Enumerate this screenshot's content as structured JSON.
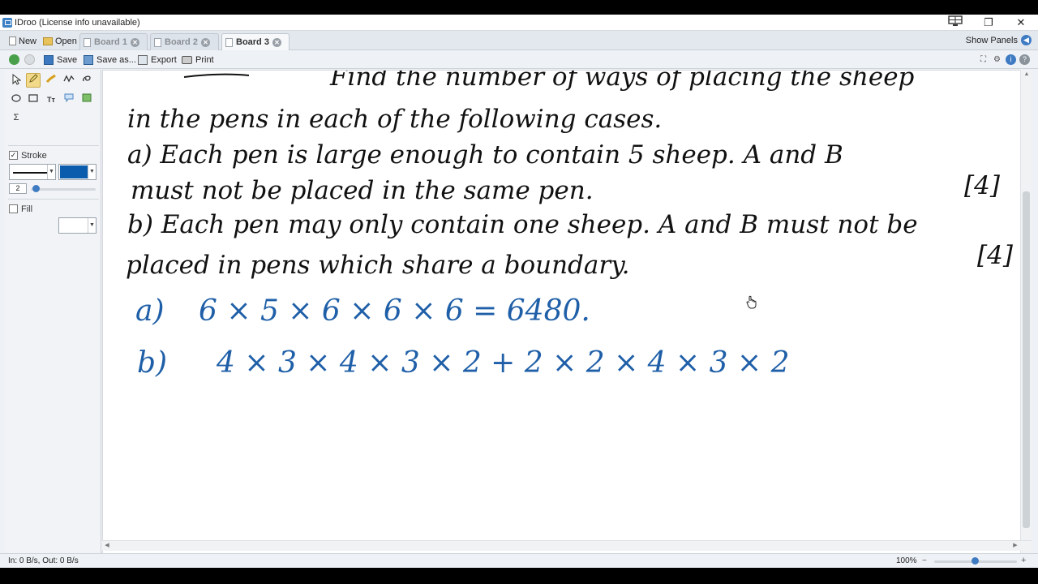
{
  "window": {
    "title": "IDroo (License info unavailable)",
    "controls": {
      "minimize": "—",
      "restore": "❐",
      "close": "✕"
    }
  },
  "tabs": {
    "new_label": "New",
    "open_label": "Open",
    "boards": [
      {
        "label": "Board 1",
        "active": false
      },
      {
        "label": "Board 2",
        "active": false
      },
      {
        "label": "Board 3",
        "active": true
      }
    ],
    "show_panels_label": "Show Panels"
  },
  "toolbar": {
    "save_label": "Save",
    "save_as_label": "Save as...",
    "export_label": "Export",
    "print_label": "Print"
  },
  "sidebar": {
    "tools": [
      "select-tool",
      "pencil-tool",
      "highlighter-tool",
      "line-tool",
      "eraser-tool",
      "ellipse-tool",
      "rectangle-tool",
      "text-tool",
      "comment-tool",
      "image-tool",
      "formula-tool"
    ],
    "stroke_label": "Stroke",
    "stroke_checked": true,
    "stroke_color": "#0b5cad",
    "stroke_width": "2",
    "fill_label": "Fill",
    "fill_checked": false
  },
  "canvas": {
    "ink_color_question": "#111111",
    "ink_color_answer": "#1f5fa8",
    "lines": {
      "q0": "Find the number of ways of placing the sheep",
      "q1": "in the pens in each of the following cases.",
      "q2": "a) Each pen is large enough to contain 5 sheep. A and B",
      "q3": "must not be placed in the same pen.",
      "q3_marks": "[4]",
      "q4": "b) Each pen may only contain one sheep. A and B must not be",
      "q5": "placed in pens which share a boundary.",
      "q5_marks": "[4]",
      "a_label": "a)",
      "a_work": "6 × 5 × 6 × 6 × 6  =  6480.",
      "b_label": "b)",
      "b_work": "4 × 3 × 4 × 3 × 2   + 2 × 2 × 4 × 3 × 2"
    }
  },
  "status": {
    "traffic": "In: 0 B/s, Out: 0 B/s",
    "zoom": "100%",
    "zoom_minus": "−",
    "zoom_plus": "+"
  }
}
